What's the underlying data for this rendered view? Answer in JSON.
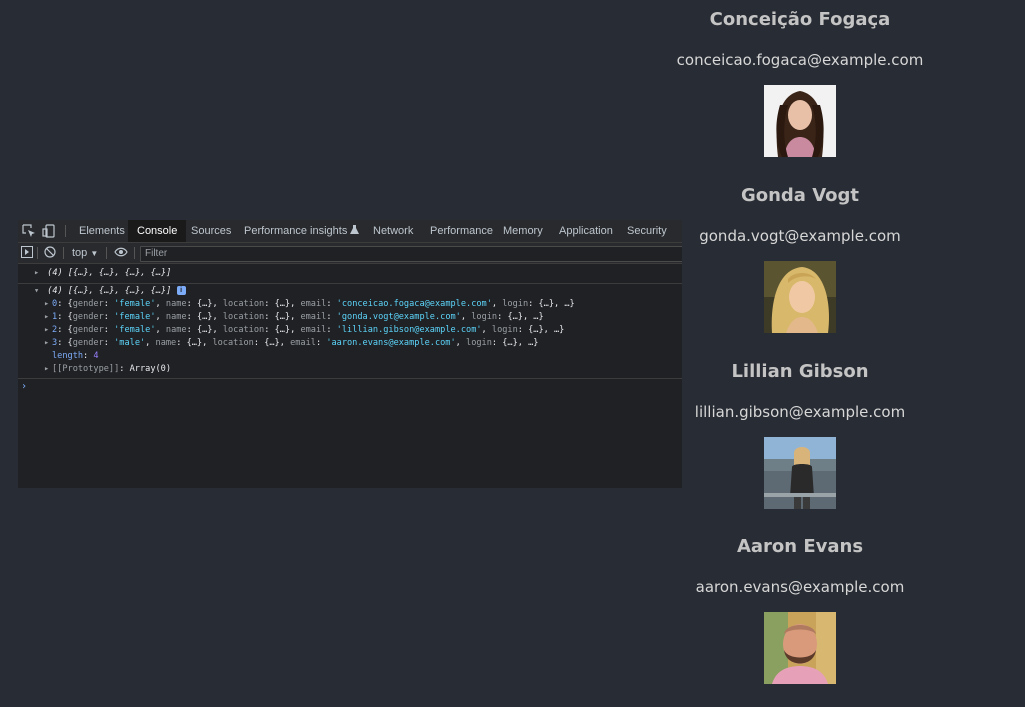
{
  "users": [
    {
      "name": "Conceição Fogaça",
      "email": "conceicao.fogaca@example.com",
      "avatar": "woman-curly-hair-photo"
    },
    {
      "name": "Gonda Vogt",
      "email": "gonda.vogt@example.com",
      "avatar": "woman-blonde-photo"
    },
    {
      "name": "Lillian Gibson",
      "email": "lillian.gibson@example.com",
      "avatar": "woman-river-photo"
    },
    {
      "name": "Aaron Evans",
      "email": "aaron.evans@example.com",
      "avatar": "man-beard-photo"
    }
  ],
  "devtools": {
    "tabs": [
      {
        "label": "Elements"
      },
      {
        "label": "Console"
      },
      {
        "label": "Sources"
      },
      {
        "label": "Performance insights"
      },
      {
        "label": "Network"
      },
      {
        "label": "Performance"
      },
      {
        "label": "Memory"
      },
      {
        "label": "Application"
      },
      {
        "label": "Security"
      }
    ],
    "active_tab": "Console",
    "toolbar": {
      "context": "top",
      "filter_placeholder": "Filter"
    },
    "console": {
      "collapsed_summary": "(4) [{…}, {…}, {…}, {…}]",
      "expanded_summary": "(4) [{…}, {…}, {…}, {…}]",
      "info_badge": "i",
      "entries": [
        {
          "index": "0",
          "gender": "'female'",
          "email": "'conceicao.fogaca@example.com'"
        },
        {
          "index": "1",
          "gender": "'female'",
          "email": "'gonda.vogt@example.com'"
        },
        {
          "index": "2",
          "gender": "'female'",
          "email": "'lillian.gibson@example.com'"
        },
        {
          "index": "3",
          "gender": "'male'",
          "email": "'aaron.evans@example.com'"
        }
      ],
      "length_key": "length",
      "length_value": "4",
      "prototype_key": "[[Prototype]]",
      "prototype_value": "Array(0)",
      "prompt": "›"
    }
  }
}
